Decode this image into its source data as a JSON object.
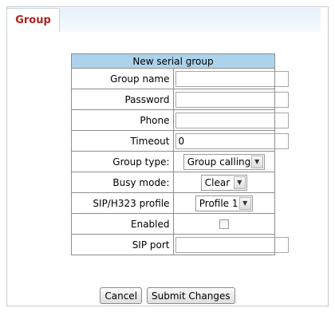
{
  "tabs": [
    {
      "label": "Group"
    }
  ],
  "form": {
    "title": "New serial group",
    "fields": {
      "group_name": {
        "label": "Group name",
        "value": ""
      },
      "password": {
        "label": "Password",
        "value": ""
      },
      "phone": {
        "label": "Phone",
        "value": ""
      },
      "timeout": {
        "label": "Timeout",
        "value": "0"
      },
      "group_type": {
        "label": "Group type:",
        "value": "Group calling"
      },
      "busy_mode": {
        "label": "Busy mode:",
        "value": "Clear"
      },
      "sip_profile": {
        "label": "SIP/H323 profile",
        "value": "Profile 1"
      },
      "enabled": {
        "label": "Enabled",
        "checked": false
      },
      "sip_port": {
        "label": "SIP port",
        "value": ""
      }
    }
  },
  "buttons": {
    "cancel": "Cancel",
    "submit": "Submit Changes"
  },
  "icons": {
    "dropdown_arrow": "▼"
  }
}
